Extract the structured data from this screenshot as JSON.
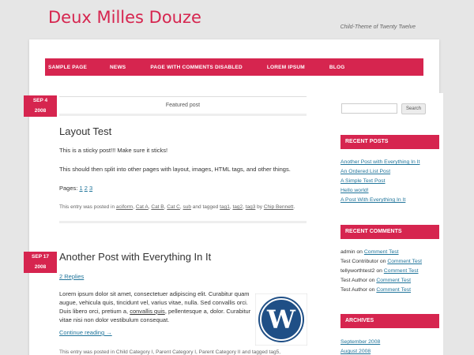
{
  "site": {
    "title": "Deux Milles Douze",
    "description": "Child-Theme of Twenty Twelve"
  },
  "nav": {
    "items": [
      "Sample Page",
      "News",
      "Page with comments disabled",
      "Lorem Ipsum",
      "Blog"
    ]
  },
  "post1": {
    "date_month": "SEP 4",
    "date_year": "2008",
    "featured": "Featured post",
    "title": "Layout Test",
    "p1": "This is a sticky post!!! Make sure it sticks!",
    "p2": "This should then split into other pages with layout, images, HTML tags, and other things.",
    "pages_label": "Pages: ",
    "page_links": [
      "1",
      "2",
      "3"
    ],
    "meta": {
      "prefix": "This entry was posted in ",
      "cats": [
        "aciform",
        "Cat A",
        "Cat B",
        "Cat C",
        "sub"
      ],
      "tagged": " and tagged ",
      "tags": [
        "tag1",
        "tag2",
        "tag3"
      ],
      "by": " by ",
      "author": "Chip Bennett"
    }
  },
  "post2": {
    "date_month": "SEP 17",
    "date_year": "2008",
    "title": "Another Post with Everything In It",
    "replies": "2 Replies",
    "body_a": "Lorem ipsum dolor sit amet, consectetuer adipiscing elit. Curabitur quam augue, vehicula quis, tincidunt vel, varius vitae, nulla. Sed convallis orci. Duis libero orci, pretium a, ",
    "body_link": "convallis quis",
    "body_b": ", pellentesque a, dolor. Curabitur vitae nisi non dolor vestibulum consequat.",
    "continue": "Continue reading →",
    "meta": "This entry was posted in Child Category I, Parent Category I, Parent Category II and tagged tag5, "
  },
  "search": {
    "button": "Search",
    "placeholder": ""
  },
  "widgets": {
    "recent_posts": {
      "title": "Recent Posts",
      "items": [
        "Another Post with Everything In It",
        "An Ordered List Post",
        "A Simple Text Post",
        "Hello world!",
        "A Post With Everything In It"
      ]
    },
    "recent_comments": {
      "title": "Recent Comments",
      "items": [
        {
          "author": "admin",
          "on": " on ",
          "post": "Comment Test"
        },
        {
          "author": "Test Contributor",
          "on": " on ",
          "post": "Comment Test"
        },
        {
          "author": "tellyworthtest2",
          "on": " on ",
          "post": "Comment Test"
        },
        {
          "author": "Test Author",
          "on": " on ",
          "post": "Comment Test"
        },
        {
          "author": "Test Author",
          "on": " on ",
          "post": "Comment Test"
        }
      ]
    },
    "archives": {
      "title": "Archives",
      "items": [
        "September 2008",
        "August 2008"
      ]
    }
  },
  "colors": {
    "accent": "#d6254f",
    "link": "#21759b"
  },
  "icons": {
    "post_image": "wordpress-logo-icon"
  }
}
